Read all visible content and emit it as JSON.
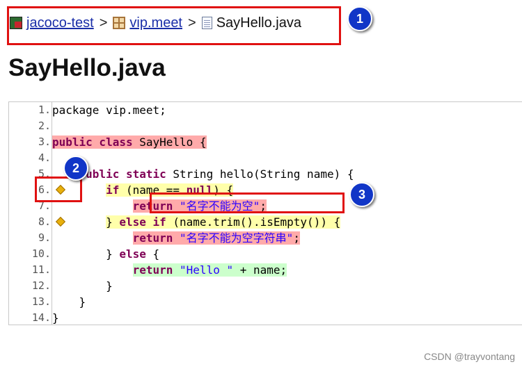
{
  "breadcrumb": {
    "project": "jacoco-test",
    "package": "vip.meet",
    "file": "SayHello.java",
    "separator": ">"
  },
  "page_title": "SayHello.java",
  "annotations": [
    "1",
    "2",
    "3"
  ],
  "code": {
    "lines": [
      {
        "n": "1.",
        "cov": "",
        "tokens": [
          {
            "t": "package vip.meet;",
            "k": ""
          }
        ]
      },
      {
        "n": "2.",
        "cov": "",
        "tokens": []
      },
      {
        "n": "3.",
        "cov": "pc",
        "tokens": [
          {
            "t": "public class",
            "k": "kw"
          },
          {
            "t": " SayHello {",
            "k": ""
          }
        ]
      },
      {
        "n": "4.",
        "cov": "",
        "tokens": []
      },
      {
        "n": "5.",
        "cov": "",
        "indent": "    ",
        "tokens": [
          {
            "t": "public static",
            "k": "kw"
          },
          {
            "t": " String hello(String name) {",
            "k": ""
          }
        ]
      },
      {
        "n": "6.",
        "cov": "bc",
        "diamond": true,
        "indent": "        ",
        "tokens": [
          {
            "t": "if",
            "k": "kw"
          },
          {
            "t": " (name == ",
            "k": ""
          },
          {
            "t": "null",
            "k": "kw"
          },
          {
            "t": ") {",
            "k": ""
          }
        ]
      },
      {
        "n": "7.",
        "cov": "pc",
        "indent": "            ",
        "tokens": [
          {
            "t": "return",
            "k": "kw"
          },
          {
            "t": " ",
            "k": ""
          },
          {
            "t": "\"名字不能为空\"",
            "k": "str"
          },
          {
            "t": ";",
            "k": ""
          }
        ]
      },
      {
        "n": "8.",
        "cov": "bc",
        "diamond": true,
        "indent": "        ",
        "tokens": [
          {
            "t": "} ",
            "k": ""
          },
          {
            "t": "else if",
            "k": "kw"
          },
          {
            "t": " (name.trim().isEmpty()) {",
            "k": ""
          }
        ]
      },
      {
        "n": "9.",
        "cov": "pc",
        "indent": "            ",
        "tokens": [
          {
            "t": "return",
            "k": "kw"
          },
          {
            "t": " ",
            "k": ""
          },
          {
            "t": "\"名字不能为空字符串\"",
            "k": "str"
          },
          {
            "t": ";",
            "k": ""
          }
        ]
      },
      {
        "n": "10.",
        "cov": "",
        "indent": "        ",
        "tokens": [
          {
            "t": "} ",
            "k": ""
          },
          {
            "t": "else",
            "k": "kw"
          },
          {
            "t": " {",
            "k": ""
          }
        ]
      },
      {
        "n": "11.",
        "cov": "fc",
        "indent": "            ",
        "tokens": [
          {
            "t": "return",
            "k": "kw"
          },
          {
            "t": " ",
            "k": ""
          },
          {
            "t": "\"Hello \"",
            "k": "str"
          },
          {
            "t": " + name;",
            "k": ""
          }
        ]
      },
      {
        "n": "12.",
        "cov": "",
        "indent": "        ",
        "tokens": [
          {
            "t": "}",
            "k": ""
          }
        ]
      },
      {
        "n": "13.",
        "cov": "",
        "indent": "    ",
        "tokens": [
          {
            "t": "}",
            "k": ""
          }
        ]
      },
      {
        "n": "14.",
        "cov": "",
        "tokens": [
          {
            "t": "}",
            "k": ""
          }
        ]
      }
    ]
  },
  "colors": {
    "not_covered": "#ffaaaa",
    "partially_covered": "#ffffaa",
    "fully_covered": "#ccffcc",
    "annotation_box": "#e01111",
    "badge": "#1136c7"
  },
  "icons": {
    "project": "project-icon",
    "package": "package-icon",
    "file": "java-file-icon",
    "branch": "branch-diamond-icon"
  },
  "watermark": "CSDN @trayvontang"
}
